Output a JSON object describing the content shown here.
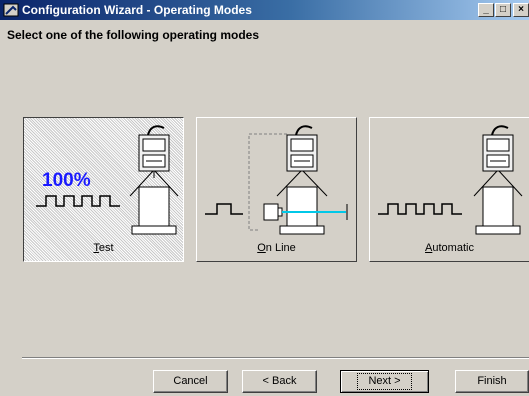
{
  "window": {
    "title": "Configuration Wizard - Operating Modes",
    "min_icon": "minimize-icon",
    "max_icon": "maximize-icon",
    "close_icon": "close-icon"
  },
  "heading": "Select one of the following operating modes",
  "modes": [
    {
      "hotkey": "T",
      "rest": "est",
      "selected": true,
      "percent": "100%"
    },
    {
      "hotkey": "O",
      "rest": "n Line",
      "selected": false
    },
    {
      "hotkey": "A",
      "rest": "utomatic",
      "selected": false
    }
  ],
  "buttons": {
    "cancel": "Cancel",
    "back": "< Back",
    "next": "Next >",
    "finish": "Finish"
  },
  "colors": {
    "percent_text": "#1a1aff",
    "beam": "#00c8e8",
    "title_start": "#0a246a"
  }
}
